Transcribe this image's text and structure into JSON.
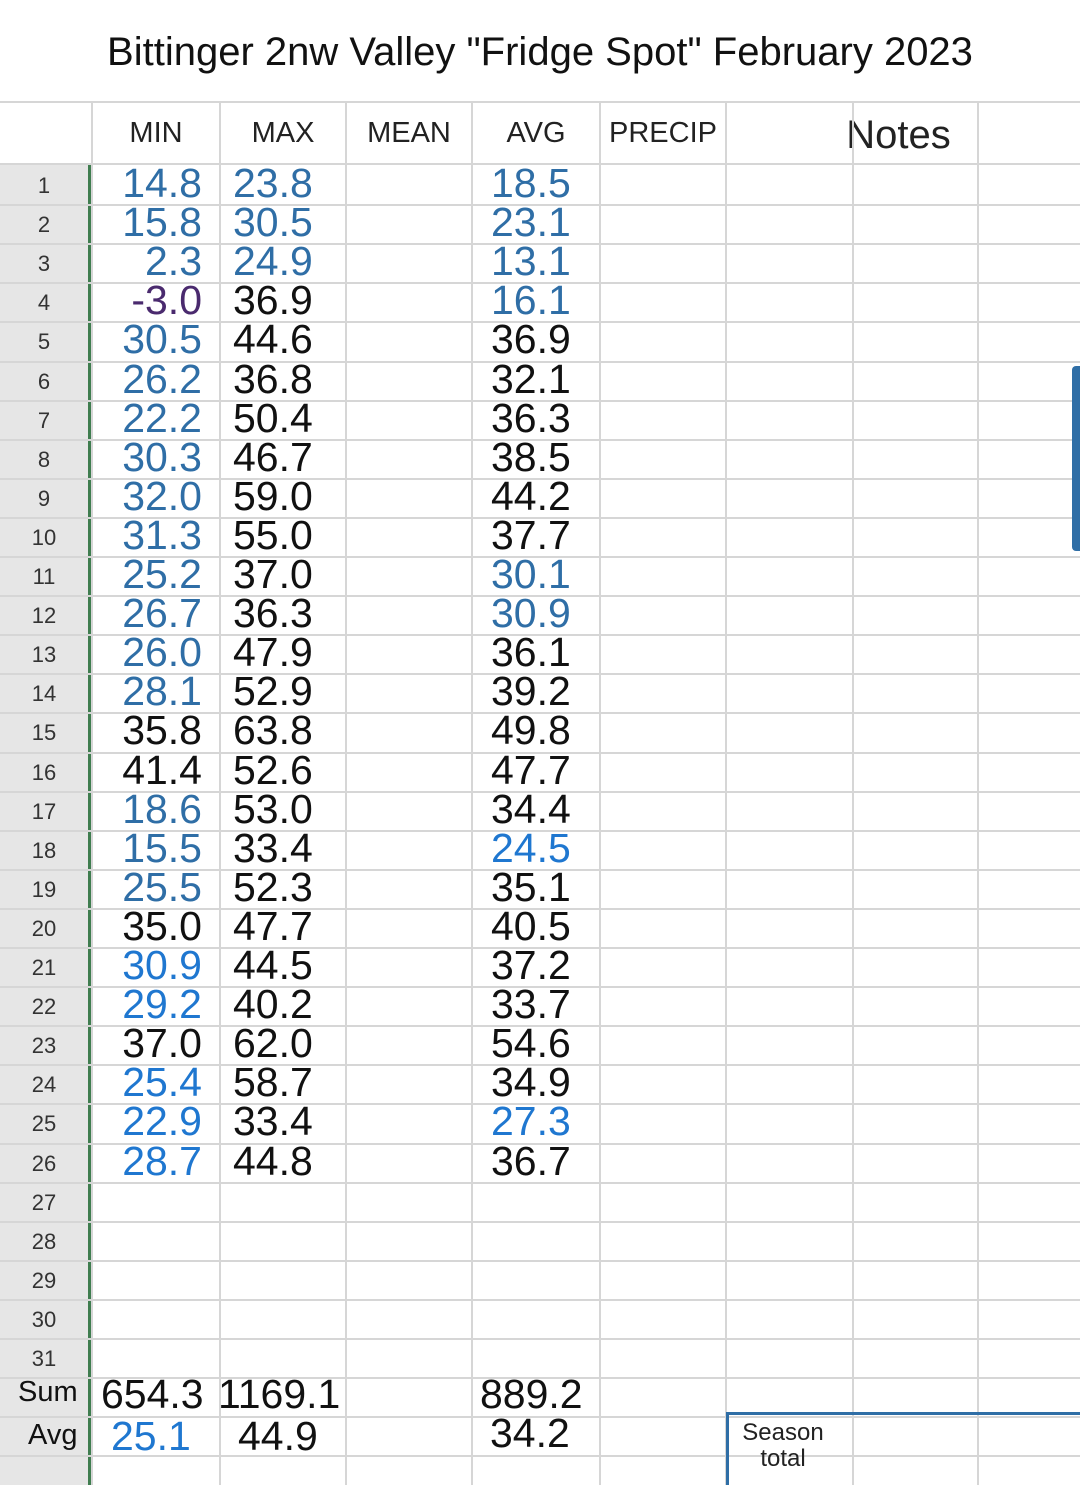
{
  "title": "Bittinger 2nw Valley \"Fridge Spot\" February 2023",
  "headers": {
    "min": "MIN",
    "max": "MAX",
    "mean": "MEAN",
    "avg": "AVG",
    "precip": "PRECIP",
    "notes": "Notes"
  },
  "row_numbers": [
    "1",
    "2",
    "3",
    "4",
    "5",
    "6",
    "7",
    "8",
    "9",
    "10",
    "11",
    "12",
    "13",
    "14",
    "15",
    "16",
    "17",
    "18",
    "19",
    "20",
    "21",
    "22",
    "23",
    "24",
    "25",
    "26",
    "27",
    "28",
    "29",
    "30",
    "31"
  ],
  "rows": [
    {
      "min": "14.8",
      "min_color": "blue",
      "max": "23.8",
      "max_color": "blue",
      "avg": "18.5",
      "avg_color": "blue"
    },
    {
      "min": "15.8",
      "min_color": "blue",
      "max": "30.5",
      "max_color": "blue",
      "avg": "23.1",
      "avg_color": "blue"
    },
    {
      "min": "2.3",
      "min_color": "blue",
      "max": "24.9",
      "max_color": "blue",
      "avg": "13.1",
      "avg_color": "blue"
    },
    {
      "min": "-3.0",
      "min_color": "purple",
      "max": "36.9",
      "max_color": "black",
      "avg": "16.1",
      "avg_color": "blue"
    },
    {
      "min": "30.5",
      "min_color": "blue",
      "max": "44.6",
      "max_color": "black",
      "avg": "36.9",
      "avg_color": "black"
    },
    {
      "min": "26.2",
      "min_color": "blue",
      "max": "36.8",
      "max_color": "black",
      "avg": "32.1",
      "avg_color": "black"
    },
    {
      "min": "22.2",
      "min_color": "blue",
      "max": "50.4",
      "max_color": "black",
      "avg": "36.3",
      "avg_color": "black"
    },
    {
      "min": "30.3",
      "min_color": "blue",
      "max": "46.7",
      "max_color": "black",
      "avg": "38.5",
      "avg_color": "black"
    },
    {
      "min": "32.0",
      "min_color": "blue",
      "max": "59.0",
      "max_color": "black",
      "avg": "44.2",
      "avg_color": "black"
    },
    {
      "min": "31.3",
      "min_color": "blue",
      "max": "55.0",
      "max_color": "black",
      "avg": "37.7",
      "avg_color": "black"
    },
    {
      "min": "25.2",
      "min_color": "blue",
      "max": "37.0",
      "max_color": "black",
      "avg": "30.1",
      "avg_color": "blue"
    },
    {
      "min": "26.7",
      "min_color": "blue",
      "max": "36.3",
      "max_color": "black",
      "avg": "30.9",
      "avg_color": "blue"
    },
    {
      "min": "26.0",
      "min_color": "blue",
      "max": "47.9",
      "max_color": "black",
      "avg": "36.1",
      "avg_color": "black"
    },
    {
      "min": "28.1",
      "min_color": "blue",
      "max": "52.9",
      "max_color": "black",
      "avg": "39.2",
      "avg_color": "black"
    },
    {
      "min": "35.8",
      "min_color": "black",
      "max": "63.8",
      "max_color": "black",
      "avg": "49.8",
      "avg_color": "black"
    },
    {
      "min": "41.4",
      "min_color": "black",
      "max": "52.6",
      "max_color": "black",
      "avg": "47.7",
      "avg_color": "black"
    },
    {
      "min": "18.6",
      "min_color": "blue",
      "max": "53.0",
      "max_color": "black",
      "avg": "34.4",
      "avg_color": "black"
    },
    {
      "min": "15.5",
      "min_color": "blue",
      "max": "33.4",
      "max_color": "black",
      "avg": "24.5",
      "avg_color": "bright"
    },
    {
      "min": "25.5",
      "min_color": "blue",
      "max": "52.3",
      "max_color": "black",
      "avg": "35.1",
      "avg_color": "black"
    },
    {
      "min": "35.0",
      "min_color": "black",
      "max": "47.7",
      "max_color": "black",
      "avg": "40.5",
      "avg_color": "black"
    },
    {
      "min": "30.9",
      "min_color": "bright",
      "max": "44.5",
      "max_color": "black",
      "avg": "37.2",
      "avg_color": "black"
    },
    {
      "min": "29.2",
      "min_color": "bright",
      "max": "40.2",
      "max_color": "black",
      "avg": "33.7",
      "avg_color": "black"
    },
    {
      "min": "37.0",
      "min_color": "black",
      "max": "62.0",
      "max_color": "black",
      "avg": "54.6",
      "avg_color": "black"
    },
    {
      "min": "25.4",
      "min_color": "bright",
      "max": "58.7",
      "max_color": "black",
      "avg": "34.9",
      "avg_color": "black"
    },
    {
      "min": "22.9",
      "min_color": "bright",
      "max": "33.4",
      "max_color": "black",
      "avg": "27.3",
      "avg_color": "bright"
    },
    {
      "min": "28.7",
      "min_color": "bright",
      "max": "44.8",
      "max_color": "black",
      "avg": "36.7",
      "avg_color": "black"
    }
  ],
  "sum": {
    "label": "Sum",
    "min": "654.3",
    "max": "1169.1",
    "avg": "889.2"
  },
  "avg_row": {
    "label": "Avg",
    "min": "25.1",
    "max": "44.9",
    "avg": "34.2",
    "min_color": "bright"
  },
  "season_total": {
    "line1": "Season",
    "line2": "total"
  },
  "colors": {
    "blue": "#2f6ea6",
    "bright": "#1f77d0",
    "black": "#111111",
    "purple": "#4a2a6e",
    "grid": "#d6d6d6",
    "rowheader_bg": "#e6e6e6",
    "freeze_bar": "#3f7d4f"
  }
}
